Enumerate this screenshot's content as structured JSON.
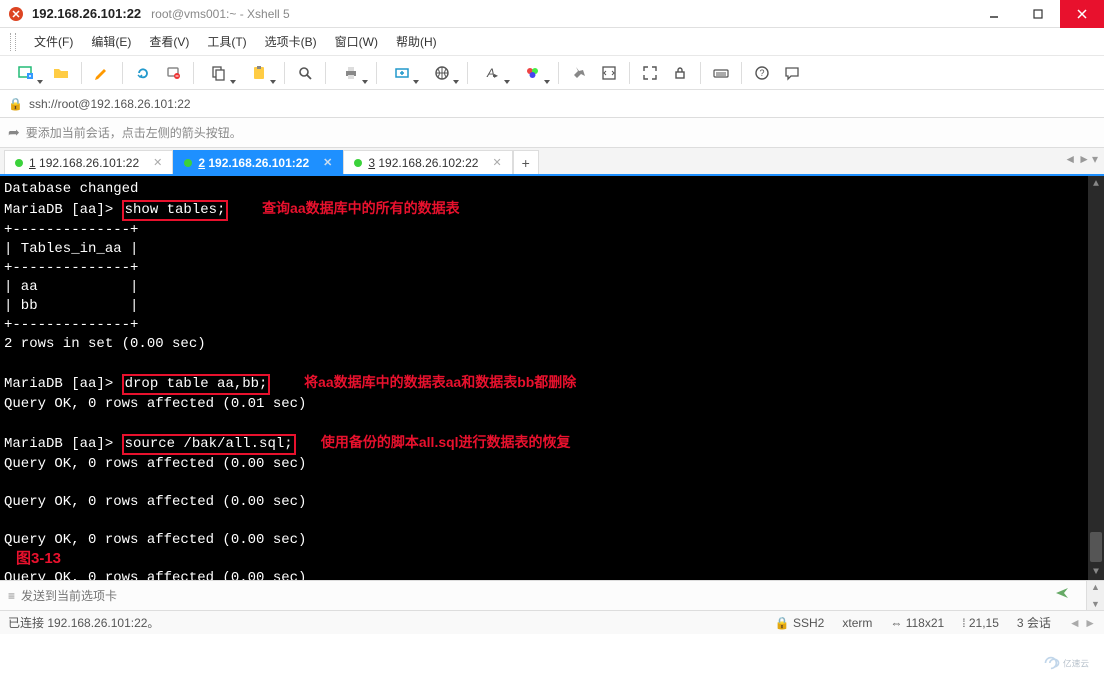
{
  "window": {
    "title_ip": "192.168.26.101:22",
    "title_path": "root@vms001:~ - Xshell 5"
  },
  "menubar": {
    "file": "文件(F)",
    "edit": "编辑(E)",
    "view": "查看(V)",
    "tools": "工具(T)",
    "tabs": "选项卡(B)",
    "window": "窗口(W)",
    "help": "帮助(H)"
  },
  "address": {
    "url": "ssh://root@192.168.26.101:22"
  },
  "hint": {
    "text": "要添加当前会话，点击左侧的箭头按钮。"
  },
  "tabs": {
    "t1_num": "1",
    "t1_label": " 192.168.26.101:22",
    "t2_num": "2",
    "t2_label": " 192.168.26.101:22",
    "t3_num": "3",
    "t3_label": " 192.168.26.102:22",
    "plus": "+"
  },
  "terminal": {
    "l0": "Database changed",
    "l1a": "MariaDB [aa]> ",
    "l1b": "show tables;",
    "ann1": "查询aa数据库中的所有的数据表",
    "l2": "+--------------+",
    "l3": "| Tables_in_aa |",
    "l4": "+--------------+",
    "l5": "| aa           |",
    "l6": "| bb           |",
    "l7": "+--------------+",
    "l8": "2 rows in set (0.00 sec)",
    "l9": "",
    "l10a": "MariaDB [aa]> ",
    "l10b": "drop table aa,bb;",
    "ann2": "将aa数据库中的数据表aa和数据表bb都删除",
    "l11": "Query OK, 0 rows affected (0.01 sec)",
    "l12": "",
    "l13a": "MariaDB [aa]> ",
    "l13b": "source /bak/all.sql;",
    "ann3": "使用备份的脚本all.sql进行数据表的恢复",
    "l14": "Query OK, 0 rows affected (0.00 sec)",
    "l15": "",
    "l16": "Query OK, 0 rows affected (0.00 sec)",
    "l17": "",
    "l18": "Query OK, 0 rows affected (0.00 sec)",
    "l19": "",
    "l20": "Query OK, 0 rows affected (0.00 sec)",
    "caption": "图3-13"
  },
  "compose": {
    "placeholder": "发送到当前选项卡"
  },
  "status": {
    "conn": "已连接 192.168.26.101:22。",
    "proto": "SSH2",
    "term": "xterm",
    "size": "118x21",
    "cursor": "21,15",
    "sessions": "3 会话"
  },
  "watermark_text": "亿速云"
}
